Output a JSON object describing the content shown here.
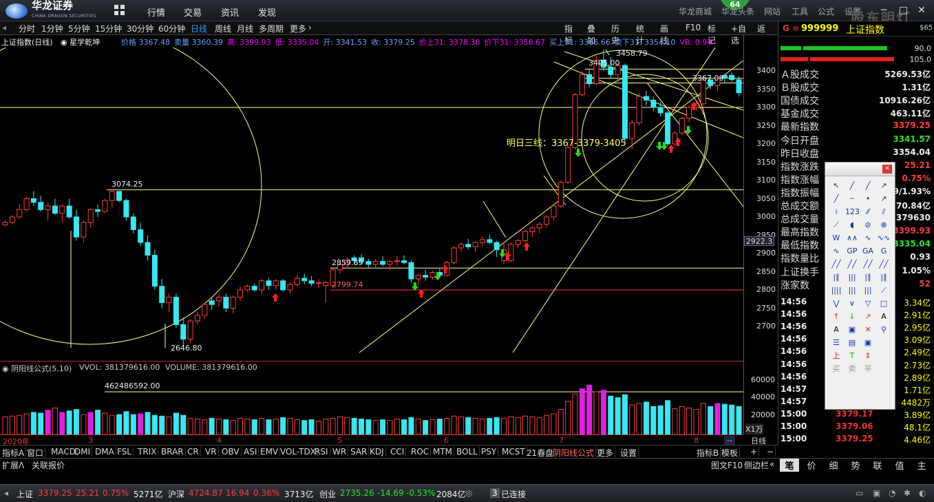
{
  "app": {
    "logo_text": "华龙证券",
    "logo_sub": "CHINA DRAGON SECURITIES",
    "menu": [
      "行情",
      "交易",
      "资讯",
      "发现"
    ],
    "right_menu": [
      "华龙商城",
      "华龙头条",
      "网站",
      "工具",
      "公式",
      "设置"
    ],
    "badge": "64",
    "watermark": "股东明灯"
  },
  "periods": {
    "items": [
      "分时",
      "1分钟",
      "5分钟",
      "15分钟",
      "30分钟",
      "60分钟",
      "日线",
      "周线",
      "月线",
      "多周期",
      "更多"
    ],
    "active": "日线"
  },
  "chart_tools": [
    "指标",
    "叠加",
    "历史",
    "统计",
    "画线",
    "F10",
    "标记",
    "+自选",
    "返回"
  ],
  "info": {
    "name": "上证指数(日线)",
    "tool": "星学乾坤",
    "segments": [
      {
        "t": "价格 3367.48",
        "c": "blue"
      },
      {
        "t": "卖量 3360.39",
        "c": "blue"
      },
      {
        "t": "高: 3399.93",
        "c": "magenta"
      },
      {
        "t": "低: 3335.04",
        "c": "magenta"
      },
      {
        "t": "开: 3341.53",
        "c": "blue"
      },
      {
        "t": "收: 3379.25",
        "c": "blue"
      },
      {
        "t": "价上31: 3378.30",
        "c": "magenta"
      },
      {
        "t": "价下31: 3356.67",
        "c": "magenta"
      },
      {
        "t": "买上31: 3366.66",
        "c": "blue"
      },
      {
        "t": "卖下31: 3354.10",
        "c": "blue"
      },
      {
        "t": "VB: 0.94",
        "c": "magenta"
      }
    ]
  },
  "annotations": {
    "high_mark": "3458.79",
    "peak_mark": "3405.00",
    "right_mark": "3367.00",
    "left_high": "3074.25",
    "low_mark": "2646.80",
    "mid1": "2859.89",
    "mid2": "2799.74",
    "forecast": "明日三线：3367-3379-3405"
  },
  "axis": {
    "ticks": [
      "3400",
      "3350",
      "3300",
      "3250",
      "3200",
      "3150",
      "3100",
      "3050",
      "3000",
      "2950",
      "2900",
      "2850",
      "2800",
      "2750",
      "2700"
    ],
    "current": "2922.3",
    "vol_ticks": [
      "60000",
      "40000",
      "20000"
    ],
    "vol_unit": "X1万",
    "period_label": "日线"
  },
  "volume": {
    "formula": "阴阳线公式(5,10)",
    "vvol": "VVOL: 381379616.00",
    "volume": "VOLUME: 381379616.00",
    "ref_label": "462486592.00"
  },
  "dates": [
    "2020年",
    "3",
    "4",
    "5",
    "6",
    "7",
    "8"
  ],
  "indicators": {
    "items": [
      "指标A",
      "窗口",
      "MACD",
      "DMI",
      "DMA",
      "FSL",
      "TRIX",
      "BRAR",
      "CR",
      "VR",
      "OBV",
      "ASI",
      "EMV",
      "VOL-TDX",
      "RSI",
      "WR",
      "SAR",
      "KDJ",
      "CCI",
      "ROC",
      "MTM",
      "BOLL",
      "PSY",
      "MCST",
      "21春盘",
      "阴阳线公式",
      "更多",
      "设置"
    ],
    "active": "阴阳线公式",
    "right": [
      "指标B",
      "模板",
      "+",
      "−"
    ]
  },
  "row2": {
    "left": [
      "扩展Λ",
      "关联报价"
    ],
    "mid": [
      "图文F10",
      "侧边栏"
    ],
    "tabs": [
      "笔",
      "价",
      "细",
      "势",
      "联",
      "值",
      "主"
    ],
    "active_tab": "笔"
  },
  "panel": {
    "g": "G",
    "code": "999999",
    "name": "上证指数",
    "side": "$65",
    "ratio1": "90.0",
    "ratio2": "105.0",
    "rows": [
      {
        "l": "Ａ股成交",
        "v": "5269.53亿",
        "c": "white"
      },
      {
        "l": "Ｂ股成交",
        "v": "1.31亿",
        "c": "white"
      },
      {
        "l": "国债成交",
        "v": "10916.26亿",
        "c": "white"
      },
      {
        "l": "基金成交",
        "v": "463.11亿",
        "c": "white"
      },
      {
        "l": "最新指数",
        "v": "3379.25",
        "c": "red"
      },
      {
        "l": "今日开盘",
        "v": "3341.57",
        "c": "green"
      },
      {
        "l": "昨日收盘",
        "v": "3354.04",
        "c": "white"
      },
      {
        "l": "指数涨跌",
        "v": "25.21",
        "c": "red"
      },
      {
        "l": "指数涨幅",
        "v": "0.75%",
        "c": "red"
      },
      {
        "l": "指数振幅",
        "v": "89/1.93%",
        "c": "white"
      },
      {
        "l": "总成交额",
        "v": "270.84亿",
        "c": "white"
      },
      {
        "l": "总成交量",
        "v": "1379630",
        "c": "white"
      },
      {
        "l": "最高指数",
        "v": "3399.93",
        "c": "red"
      },
      {
        "l": "最低指数",
        "v": "3335.04",
        "c": "green"
      },
      {
        "l": "指数量比",
        "v": "0.93",
        "c": "white"
      },
      {
        "l": "上证换手",
        "v": "1.05%",
        "c": "white"
      },
      {
        "l": "涨家数",
        "v": "52",
        "c": "red"
      }
    ],
    "ticks": [
      {
        "t": "14:56",
        "p": "",
        "q": "3.34亿"
      },
      {
        "t": "14:56",
        "p": "",
        "q": "2.91亿"
      },
      {
        "t": "14:56",
        "p": "",
        "q": "2.95亿"
      },
      {
        "t": "14:56",
        "p": "",
        "q": "3.09亿"
      },
      {
        "t": "14:56",
        "p": "",
        "q": "2.49亿"
      },
      {
        "t": "14:56",
        "p": "",
        "q": "2.73亿"
      },
      {
        "t": "14:56",
        "p": "",
        "q": "2.89亿"
      },
      {
        "t": "14:57",
        "p": "",
        "q": "1.71亿"
      },
      {
        "t": "14:57",
        "p": "",
        "q": "4482万"
      },
      {
        "t": "15:00",
        "p": "3379.17",
        "q": "3.89亿"
      },
      {
        "t": "15:00",
        "p": "3379.06",
        "q": "48.1亿"
      },
      {
        "t": "15:00",
        "p": "3379.25",
        "q": "4.46亿"
      }
    ]
  },
  "toolbox": {
    "labels": [
      "上",
      "T",
      "买",
      "卖",
      "平"
    ]
  },
  "status": {
    "sh": {
      "name": "上证",
      "price": "3379.25",
      "chg": "25.21",
      "pct": "0.75%",
      "amt": "5271亿"
    },
    "sz": {
      "name": "沪深",
      "price": "4724.87",
      "chg": "16.94",
      "pct": "0.36%",
      "amt": "3713亿"
    },
    "cy": {
      "name": "创业",
      "price": "2735.26",
      "chg": "-14.69",
      "pct": "-0.53%",
      "amt": "2084亿"
    },
    "conn_count": "3",
    "conn": "已连接"
  },
  "colors": {
    "up": "#ff3c3c",
    "down": "#38e7f0",
    "line": "#ffff88",
    "vol_up_alt": "#e020e0"
  },
  "chart_data": {
    "type": "candlestick",
    "ylim": [
      2646.8,
      3458.79
    ],
    "months": [
      "2020年",
      "3",
      "4",
      "5",
      "6",
      "7",
      "8"
    ],
    "candles": [
      [
        2978,
        2990,
        2975,
        2985,
        0
      ],
      [
        2985,
        3005,
        2980,
        3000,
        0
      ],
      [
        3000,
        3035,
        2995,
        3020,
        0
      ],
      [
        3020,
        3055,
        3015,
        3050,
        0
      ],
      [
        3050,
        3071,
        3030,
        3040,
        1
      ],
      [
        3040,
        3058,
        3015,
        3020,
        1
      ],
      [
        3020,
        3040,
        2990,
        3030,
        0
      ],
      [
        3030,
        3050,
        3005,
        3010,
        1
      ],
      [
        3010,
        3035,
        2985,
        3030,
        0
      ],
      [
        3030,
        3050,
        2995,
        3000,
        1
      ],
      [
        3000,
        3020,
        2935,
        2945,
        1
      ],
      [
        2945,
        2990,
        2930,
        2985,
        0
      ],
      [
        2985,
        3025,
        2970,
        3020,
        0
      ],
      [
        3020,
        3034,
        3000,
        3015,
        1
      ],
      [
        3015,
        3050,
        3010,
        3045,
        0
      ],
      [
        3045,
        3074.25,
        3025,
        3070,
        0
      ],
      [
        3070,
        3070,
        3040,
        3045,
        1
      ],
      [
        3045,
        3050,
        2990,
        3000,
        1
      ],
      [
        3000,
        3010,
        2955,
        2965,
        1
      ],
      [
        2965,
        2985,
        2920,
        2930,
        1
      ],
      [
        2930,
        2950,
        2880,
        2895,
        1
      ],
      [
        2895,
        2910,
        2800,
        2810,
        1
      ],
      [
        2810,
        2830,
        2750,
        2765,
        1
      ],
      [
        2765,
        2790,
        2740,
        2780,
        0
      ],
      [
        2780,
        2790,
        2695,
        2705,
        1
      ],
      [
        2705,
        2725,
        2646.8,
        2665,
        1
      ],
      [
        2665,
        2720,
        2655,
        2715,
        0
      ],
      [
        2715,
        2740,
        2705,
        2730,
        0
      ],
      [
        2730,
        2765,
        2720,
        2760,
        0
      ],
      [
        2760,
        2780,
        2745,
        2770,
        1
      ],
      [
        2770,
        2790,
        2755,
        2780,
        0
      ],
      [
        2780,
        2790,
        2740,
        2750,
        1
      ],
      [
        2750,
        2785,
        2735,
        2780,
        0
      ],
      [
        2780,
        2810,
        2770,
        2800,
        0
      ],
      [
        2800,
        2815,
        2795,
        2810,
        0
      ],
      [
        2810,
        2818,
        2795,
        2800,
        1
      ],
      [
        2800,
        2830,
        2790,
        2825,
        0
      ],
      [
        2825,
        2833,
        2800,
        2812,
        1
      ],
      [
        2812,
        2830,
        2800,
        2825,
        0
      ],
      [
        2825,
        2830,
        2795,
        2800,
        1
      ],
      [
        2800,
        2820,
        2790,
        2815,
        0
      ],
      [
        2815,
        2840,
        2810,
        2832,
        0
      ],
      [
        2832,
        2845,
        2815,
        2825,
        1
      ],
      [
        2825,
        2838,
        2810,
        2818,
        1
      ],
      [
        2818,
        2830,
        2805,
        2820,
        0
      ],
      [
        2820,
        2825,
        2765,
        2812,
        0
      ],
      [
        2812,
        2860,
        2805,
        2855,
        0
      ],
      [
        2855,
        2875,
        2845,
        2870,
        0
      ],
      [
        2870,
        2890,
        2862,
        2880,
        0
      ],
      [
        2880,
        2895,
        2870,
        2888,
        1
      ],
      [
        2888,
        2898,
        2872,
        2878,
        1
      ],
      [
        2878,
        2885,
        2862,
        2870,
        1
      ],
      [
        2870,
        2885,
        2860,
        2878,
        0
      ],
      [
        2878,
        2892,
        2865,
        2870,
        1
      ],
      [
        2870,
        2882,
        2855,
        2878,
        0
      ],
      [
        2878,
        2893,
        2865,
        2880,
        0
      ],
      [
        2880,
        2895,
        2870,
        2875,
        1
      ],
      [
        2875,
        2880,
        2820,
        2830,
        1
      ],
      [
        2830,
        2845,
        2815,
        2840,
        0
      ],
      [
        2840,
        2855,
        2825,
        2835,
        1
      ],
      [
        2835,
        2852,
        2828,
        2848,
        0
      ],
      [
        2848,
        2860,
        2835,
        2840,
        1
      ],
      [
        2840,
        2880,
        2835,
        2875,
        0
      ],
      [
        2875,
        2920,
        2870,
        2915,
        0
      ],
      [
        2915,
        2930,
        2905,
        2925,
        0
      ],
      [
        2925,
        2940,
        2910,
        2918,
        1
      ],
      [
        2918,
        2935,
        2905,
        2930,
        0
      ],
      [
        2930,
        2945,
        2920,
        2938,
        0
      ],
      [
        2938,
        2952,
        2925,
        2930,
        1
      ],
      [
        2930,
        2935,
        2890,
        2910,
        1
      ],
      [
        2910,
        2930,
        2870,
        2880,
        0
      ],
      [
        2880,
        2930,
        2875,
        2925,
        0
      ],
      [
        2925,
        2940,
        2915,
        2935,
        0
      ],
      [
        2935,
        2965,
        2930,
        2960,
        0
      ],
      [
        2960,
        2975,
        2945,
        2970,
        0
      ],
      [
        2970,
        2985,
        2955,
        2980,
        0
      ],
      [
        2980,
        3005,
        2970,
        3000,
        0
      ],
      [
        3000,
        3035,
        2990,
        3030,
        0
      ],
      [
        3030,
        3100,
        3025,
        3095,
        0
      ],
      [
        3095,
        3200,
        3090,
        3190,
        0
      ],
      [
        3190,
        3340,
        3185,
        3335,
        0
      ],
      [
        3335,
        3400,
        3330,
        3390,
        0
      ],
      [
        3390,
        3405,
        3355,
        3365,
        1
      ],
      [
        3365,
        3440,
        3360,
        3430,
        0
      ],
      [
        3430,
        3458.79,
        3400,
        3410,
        1
      ],
      [
        3410,
        3438,
        3380,
        3390,
        1
      ],
      [
        3390,
        3420,
        3370,
        3415,
        0
      ],
      [
        3415,
        3420,
        3200,
        3215,
        1
      ],
      [
        3215,
        3265,
        3185,
        3258,
        0
      ],
      [
        3258,
        3340,
        3250,
        3330,
        0
      ],
      [
        3330,
        3345,
        3305,
        3320,
        1
      ],
      [
        3320,
        3330,
        3290,
        3300,
        1
      ],
      [
        3300,
        3315,
        3275,
        3285,
        1
      ],
      [
        3285,
        3290,
        3195,
        3200,
        1
      ],
      [
        3200,
        3235,
        3195,
        3230,
        0
      ],
      [
        3230,
        3275,
        3225,
        3270,
        0
      ],
      [
        3270,
        3305,
        3260,
        3300,
        0
      ],
      [
        3300,
        3320,
        3290,
        3310,
        0
      ],
      [
        3310,
        3380,
        3305,
        3375,
        0
      ],
      [
        3375,
        3385,
        3350,
        3360,
        1
      ],
      [
        3360,
        3383,
        3345,
        3380,
        0
      ],
      [
        3380,
        3392,
        3365,
        3388,
        1
      ],
      [
        3388,
        3395,
        3370,
        3376,
        1
      ],
      [
        3376,
        3385,
        3330,
        3340,
        1
      ],
      [
        3341.53,
        3399.93,
        3335.04,
        3379.25,
        0
      ]
    ],
    "volumes": [
      [
        24,
        0
      ],
      [
        25,
        0
      ],
      [
        26,
        0
      ],
      [
        28,
        0
      ],
      [
        30,
        1
      ],
      [
        29,
        1
      ],
      [
        33,
        2
      ],
      [
        36,
        0
      ],
      [
        30,
        2
      ],
      [
        32,
        1
      ],
      [
        34,
        1
      ],
      [
        27,
        0
      ],
      [
        30,
        2
      ],
      [
        33,
        1
      ],
      [
        29,
        0
      ],
      [
        26,
        0
      ],
      [
        27,
        1
      ],
      [
        31,
        1
      ],
      [
        27,
        1
      ],
      [
        28,
        2
      ],
      [
        30,
        1
      ],
      [
        26,
        1
      ],
      [
        25,
        1
      ],
      [
        24,
        0
      ],
      [
        29,
        1
      ],
      [
        26,
        1
      ],
      [
        22,
        0
      ],
      [
        21,
        0
      ],
      [
        20,
        0
      ],
      [
        22,
        1
      ],
      [
        21,
        0
      ],
      [
        20,
        1
      ],
      [
        19,
        0
      ],
      [
        22,
        0
      ],
      [
        21,
        0
      ],
      [
        20,
        1
      ],
      [
        22,
        0
      ],
      [
        20,
        1
      ],
      [
        21,
        0
      ],
      [
        23,
        1
      ],
      [
        22,
        0
      ],
      [
        20,
        0
      ],
      [
        19,
        1
      ],
      [
        20,
        1
      ],
      [
        18,
        0
      ],
      [
        21,
        0
      ],
      [
        22,
        0
      ],
      [
        24,
        0
      ],
      [
        23,
        0
      ],
      [
        22,
        1
      ],
      [
        21,
        1
      ],
      [
        20,
        1
      ],
      [
        19,
        0
      ],
      [
        20,
        1
      ],
      [
        19,
        0
      ],
      [
        21,
        0
      ],
      [
        20,
        1
      ],
      [
        23,
        1
      ],
      [
        21,
        0
      ],
      [
        19,
        1
      ],
      [
        20,
        0
      ],
      [
        21,
        1
      ],
      [
        22,
        0
      ],
      [
        25,
        0
      ],
      [
        24,
        0
      ],
      [
        23,
        1
      ],
      [
        22,
        0
      ],
      [
        21,
        0
      ],
      [
        22,
        1
      ],
      [
        23,
        1
      ],
      [
        22,
        0
      ],
      [
        24,
        0
      ],
      [
        23,
        0
      ],
      [
        25,
        0
      ],
      [
        24,
        0
      ],
      [
        23,
        0
      ],
      [
        26,
        0
      ],
      [
        28,
        0
      ],
      [
        34,
        0
      ],
      [
        45,
        0
      ],
      [
        55,
        0
      ],
      [
        62,
        2
      ],
      [
        67,
        2
      ],
      [
        58,
        0
      ],
      [
        60,
        2
      ],
      [
        52,
        1
      ],
      [
        50,
        1
      ],
      [
        54,
        1
      ],
      [
        40,
        0
      ],
      [
        42,
        0
      ],
      [
        44,
        1
      ],
      [
        38,
        1
      ],
      [
        39,
        1
      ],
      [
        46,
        1
      ],
      [
        35,
        0
      ],
      [
        38,
        0
      ],
      [
        36,
        0
      ],
      [
        34,
        0
      ],
      [
        42,
        0
      ],
      [
        38,
        1
      ],
      [
        42,
        2
      ],
      [
        41,
        1
      ],
      [
        40,
        1
      ],
      [
        38,
        1
      ]
    ]
  }
}
